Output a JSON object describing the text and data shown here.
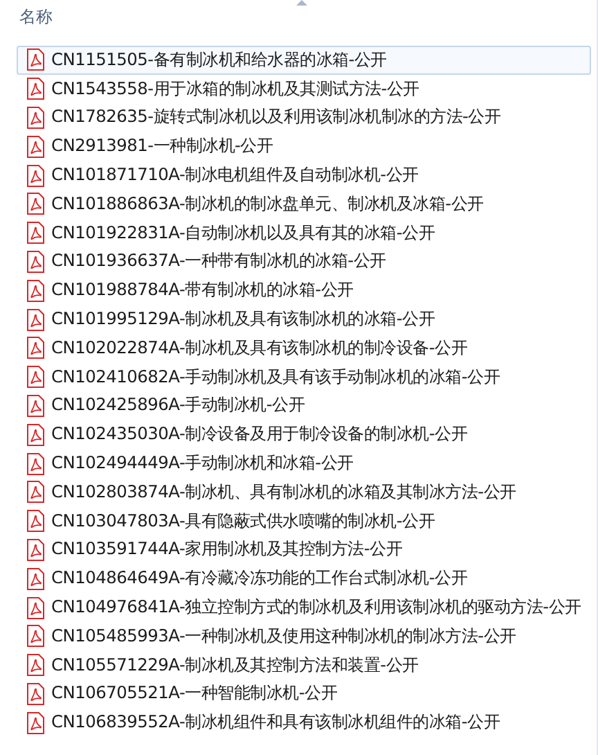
{
  "header": {
    "column_1": "名称"
  },
  "files": [
    {
      "name": "CN1151505-备有制冰机和给水器的冰箱-公开",
      "selected": true
    },
    {
      "name": "CN1543558-用于冰箱的制冰机及其测试方法-公开",
      "selected": false
    },
    {
      "name": "CN1782635-旋转式制冰机以及利用该制冰机制冰的方法-公开",
      "selected": false
    },
    {
      "name": "CN2913981-一种制冰机-公开",
      "selected": false
    },
    {
      "name": "CN101871710A-制冰电机组件及自动制冰机-公开",
      "selected": false
    },
    {
      "name": "CN101886863A-制冰机的制冰盘单元、制冰机及冰箱-公开",
      "selected": false
    },
    {
      "name": "CN101922831A-自动制冰机以及具有其的冰箱-公开",
      "selected": false
    },
    {
      "name": "CN101936637A-一种带有制冰机的冰箱-公开",
      "selected": false
    },
    {
      "name": "CN101988784A-带有制冰机的冰箱-公开",
      "selected": false
    },
    {
      "name": "CN101995129A-制冰机及具有该制冰机的冰箱-公开",
      "selected": false
    },
    {
      "name": "CN102022874A-制冰机及具有该制冰机的制冷设备-公开",
      "selected": false
    },
    {
      "name": "CN102410682A-手动制冰机及具有该手动制冰机的冰箱-公开",
      "selected": false
    },
    {
      "name": "CN102425896A-手动制冰机-公开",
      "selected": false
    },
    {
      "name": "CN102435030A-制冷设备及用于制冷设备的制冰机-公开",
      "selected": false
    },
    {
      "name": "CN102494449A-手动制冰机和冰箱-公开",
      "selected": false
    },
    {
      "name": "CN102803874A-制冰机、具有制冰机的冰箱及其制冰方法-公开",
      "selected": false
    },
    {
      "name": "CN103047803A-具有隐蔽式供水喷嘴的制冰机-公开",
      "selected": false
    },
    {
      "name": "CN103591744A-家用制冰机及其控制方法-公开",
      "selected": false
    },
    {
      "name": "CN104864649A-有冷藏冷冻功能的工作台式制冰机-公开",
      "selected": false
    },
    {
      "name": "CN104976841A-独立控制方式的制冰机及利用该制冰机的驱动方法-公开",
      "selected": false
    },
    {
      "name": "CN105485993A-一种制冰机及使用这种制冰机的制冰方法-公开",
      "selected": false
    },
    {
      "name": "CN105571229A-制冰机及其控制方法和装置-公开",
      "selected": false
    },
    {
      "name": "CN106705521A-一种智能制冰机-公开",
      "selected": false
    },
    {
      "name": "CN106839552A-制冰机组件和具有该制冰机组件的冰箱-公开",
      "selected": false
    }
  ]
}
